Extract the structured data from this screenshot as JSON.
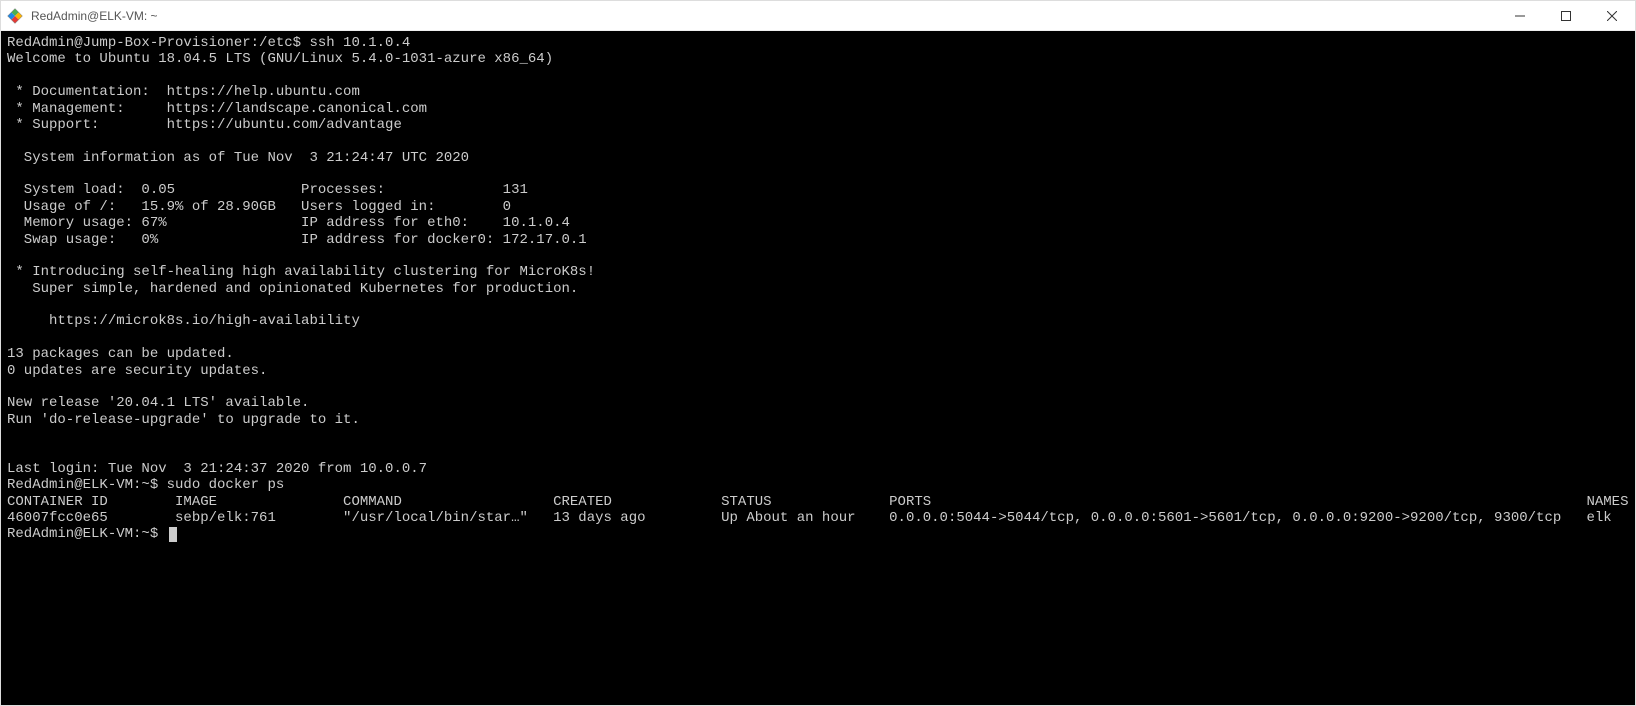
{
  "window": {
    "title": "RedAdmin@ELK-VM: ~"
  },
  "terminal": {
    "prompt1": "RedAdmin@Jump-Box-Provisioner:/etc$ ssh 10.1.0.4",
    "welcome": "Welcome to Ubuntu 18.04.5 LTS (GNU/Linux 5.4.0-1031-azure x86_64)",
    "doc_line": " * Documentation:  https://help.ubuntu.com",
    "mgmt_line": " * Management:     https://landscape.canonical.com",
    "sup_line": " * Support:        https://ubuntu.com/advantage",
    "sysinfo_header": "  System information as of Tue Nov  3 21:24:47 UTC 2020",
    "sys_load": "  System load:  0.05               Processes:              131",
    "usage": "  Usage of /:   15.9% of 28.90GB   Users logged in:        0",
    "mem": "  Memory usage: 67%                IP address for eth0:    10.1.0.4",
    "swap": "  Swap usage:   0%                 IP address for docker0: 172.17.0.1",
    "microk8s1": " * Introducing self-healing high availability clustering for MicroK8s!",
    "microk8s2": "   Super simple, hardened and opinionated Kubernetes for production.",
    "microk8s3": "     https://microk8s.io/high-availability",
    "pkg1": "13 packages can be updated.",
    "pkg2": "0 updates are security updates.",
    "rel1": "New release '20.04.1 LTS' available.",
    "rel2": "Run 'do-release-upgrade' to upgrade to it.",
    "lastlogin": "Last login: Tue Nov  3 21:24:37 2020 from 10.0.0.7",
    "prompt2": "RedAdmin@ELK-VM:~$ sudo docker ps",
    "docker_header": "CONTAINER ID        IMAGE               COMMAND                  CREATED             STATUS              PORTS                                                                              NAMES",
    "docker_row": "46007fcc0e65        sebp/elk:761        \"/usr/local/bin/star…\"   13 days ago         Up About an hour    0.0.0.0:5044->5044/tcp, 0.0.0.0:5601->5601/tcp, 0.0.0.0:9200->9200/tcp, 9300/tcp   elk",
    "prompt3": "RedAdmin@ELK-VM:~$ "
  },
  "docker_ps": {
    "container_id": "46007fcc0e65",
    "image": "sebp/elk:761",
    "command": "\"/usr/local/bin/star…\"",
    "created": "13 days ago",
    "status": "Up About an hour",
    "ports": "0.0.0.0:5044->5044/tcp, 0.0.0.0:5601->5601/tcp, 0.0.0.0:9200->9200/tcp, 9300/tcp",
    "names": "elk"
  }
}
